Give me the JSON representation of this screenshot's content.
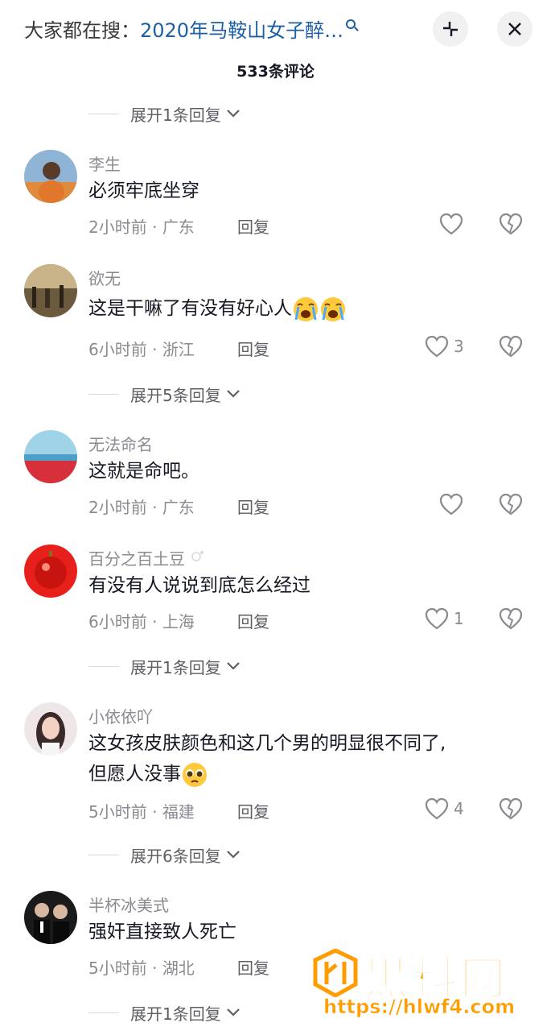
{
  "header": {
    "search_prefix": "大家都在搜：",
    "search_query": "2020年马鞍山女子醉…",
    "comment_count": "533条评论"
  },
  "expanders": [
    {
      "label": "展开1条回复"
    },
    {
      "label": "展开5条回复"
    },
    {
      "label": "展开1条回复"
    },
    {
      "label": "展开6条回复"
    },
    {
      "label": "展开1条回复"
    }
  ],
  "comments": [
    {
      "user": "李生",
      "text": "必须牢底坐穿",
      "time": "2小时前",
      "region": "广东",
      "reply": "回复",
      "likes": ""
    },
    {
      "user": "欲无",
      "text": "这是干嘛了有没有好心人",
      "time": "6小时前",
      "region": "浙江",
      "reply": "回复",
      "likes": "3"
    },
    {
      "user": "无法命名",
      "text": "这就是命吧。",
      "time": "2小时前",
      "region": "广东",
      "reply": "回复",
      "likes": ""
    },
    {
      "user": "百分之百土豆",
      "text": "有没有人说说到底怎么经过",
      "time": "6小时前",
      "region": "上海",
      "reply": "回复",
      "likes": "1"
    },
    {
      "user": "小依依吖",
      "text_line1": "这女孩皮肤颜色和这几个男的明显很不同了,",
      "text_line2": "但愿人没事",
      "time": "5小时前",
      "region": "福建",
      "reply": "回复",
      "likes": "4"
    },
    {
      "user": "半杯冰美式",
      "text": "强奸直接致人死亡",
      "time": "5小时前",
      "region": "湖北",
      "reply": "回复",
      "likes": ""
    }
  ],
  "separator": "·",
  "watermark": {
    "title": "黑料网",
    "url": "https://hlwf4.com"
  },
  "colors": {
    "link_blue": "#1c5fa6",
    "meta_grey": "#8a8b91",
    "watermark_orange": "#ff9d00"
  }
}
